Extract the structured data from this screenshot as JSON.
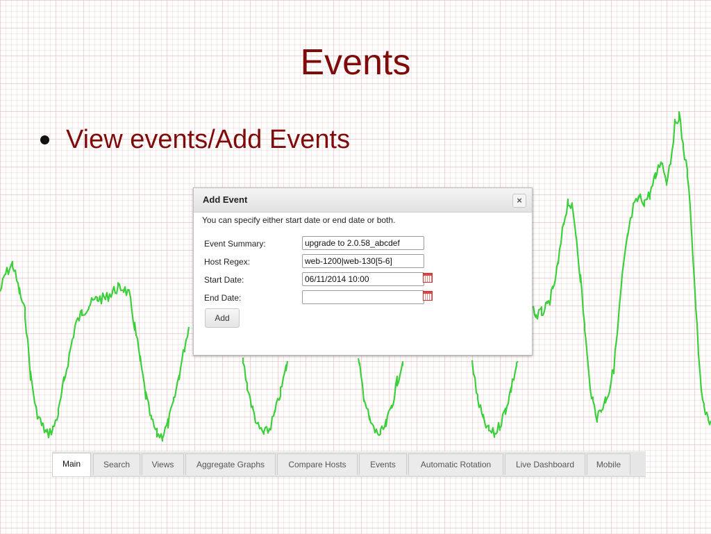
{
  "slide": {
    "title": "Events",
    "bullet": "View events/Add Events"
  },
  "dialog": {
    "title": "Add Event",
    "close_label": "×",
    "note": "You can specify either start date or end date or both.",
    "fields": {
      "summary": {
        "label": "Event Summary:",
        "value": "upgrade to 2.0.58_abcdef"
      },
      "host_regex": {
        "label": "Host Regex:",
        "value": "web-1200|web-130[5-6]"
      },
      "start_date": {
        "label": "Start Date:",
        "value": "06/11/2014 10:00"
      },
      "end_date": {
        "label": "End Date:",
        "value": ""
      }
    },
    "add_button": "Add"
  },
  "tabs": {
    "main": "Main",
    "search": "Search",
    "views": "Views",
    "aggregate": "Aggregate Graphs",
    "compare": "Compare Hosts",
    "events": "Events",
    "rotation": "Automatic Rotation",
    "live": "Live Dashboard",
    "mobile": "Mobile"
  },
  "colors": {
    "title": "#7f0a0a",
    "wave": "#3ccf3c",
    "grid": "#e29696"
  },
  "icons": {
    "calendar": "calendar-icon",
    "close": "close-icon",
    "bullet": "bullet-dot"
  }
}
